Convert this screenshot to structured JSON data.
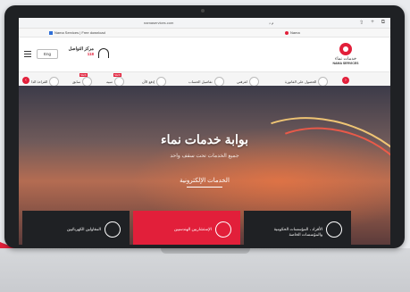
{
  "browser": {
    "url": "namaservices.com",
    "addr_badge": "م د",
    "tab1": "Nama Services | Free download",
    "tab2": "Nama"
  },
  "header": {
    "lang": "Eng",
    "contact_title": "مركز التواصل",
    "contact_number": "118",
    "logo_ar": "خدمات نماء",
    "logo_en": "NAMA SERVICES"
  },
  "services": [
    {
      "label": "الحصول على الفاتورة",
      "new": false
    },
    {
      "label": "لغرفتي",
      "new": false
    },
    {
      "label": "تفاصيل الحساب",
      "new": false
    },
    {
      "label": "إدفع الآن",
      "new": false
    },
    {
      "label": "تنبيه",
      "new": true
    },
    {
      "label": "سابق",
      "new": true
    },
    {
      "label": "القراءة الذا",
      "new": false
    }
  ],
  "hero": {
    "title": "بوابة خدمات نماء",
    "subtitle": "جميع الخدمات تحت سقف واحد",
    "section_heading": "الخدمات الإلكترونية"
  },
  "cards": [
    {
      "label": "المقاولين الكهربائيين"
    },
    {
      "label": "الإستشاريين الهندسيين"
    },
    {
      "label": "الأفراد ، المؤسسات الحكومية والمؤسسات الخاصة"
    }
  ]
}
